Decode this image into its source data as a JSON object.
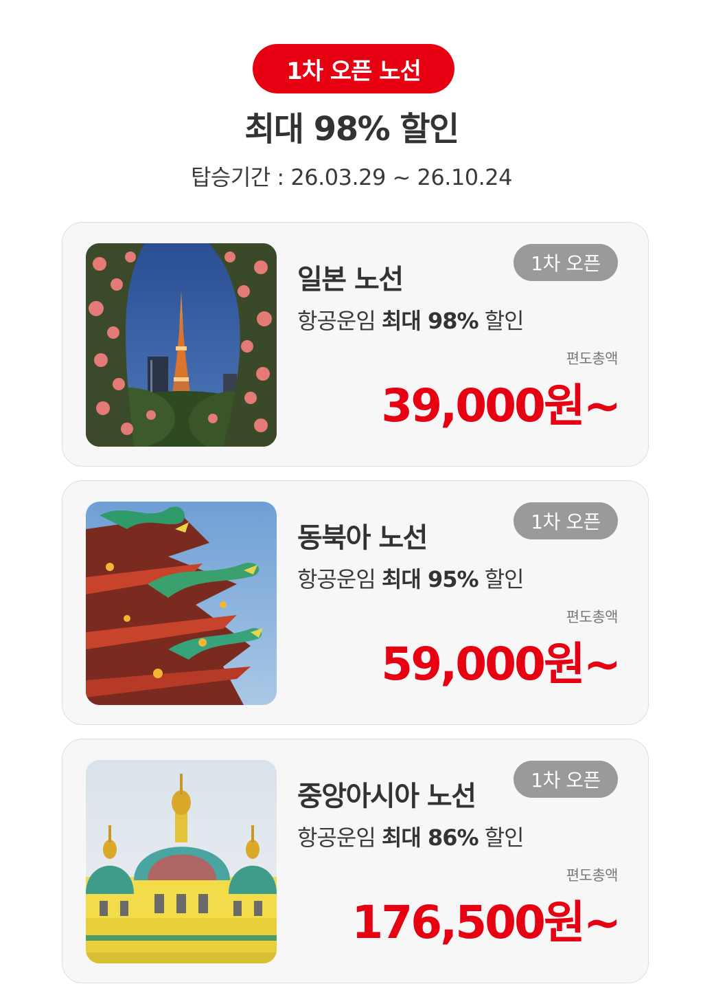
{
  "header": {
    "badge": "1차 오픈 노선",
    "headline": "최대 98% 할인",
    "period": "탑승기간 : 26.03.29 ~ 26.10.24"
  },
  "colors": {
    "accent": "#e60012",
    "badge_gray": "#9a9a9a",
    "card_bg": "#f7f7f7"
  },
  "cards": [
    {
      "image": "tokyo-tower-roses-image",
      "badge": "1차 오픈",
      "route": "일본 노선",
      "fare_prefix": "항공운임 ",
      "fare_bold": "최대 98%",
      "fare_suffix": " 할인",
      "note": "편도총액",
      "price": "39,000원~"
    },
    {
      "image": "temple-dragon-roof-image",
      "badge": "1차 오픈",
      "route": "동북아 노선",
      "fare_prefix": "항공운임 ",
      "fare_bold": "최대 95%",
      "fare_suffix": " 할인",
      "note": "편도총액",
      "price": "59,000원~"
    },
    {
      "image": "cathedral-domes-image",
      "badge": "1차 오픈",
      "route": "중앙아시아 노선",
      "fare_prefix": "항공운임 ",
      "fare_bold": "최대 86%",
      "fare_suffix": " 할인",
      "note": "편도총액",
      "price": "176,500원~"
    }
  ]
}
